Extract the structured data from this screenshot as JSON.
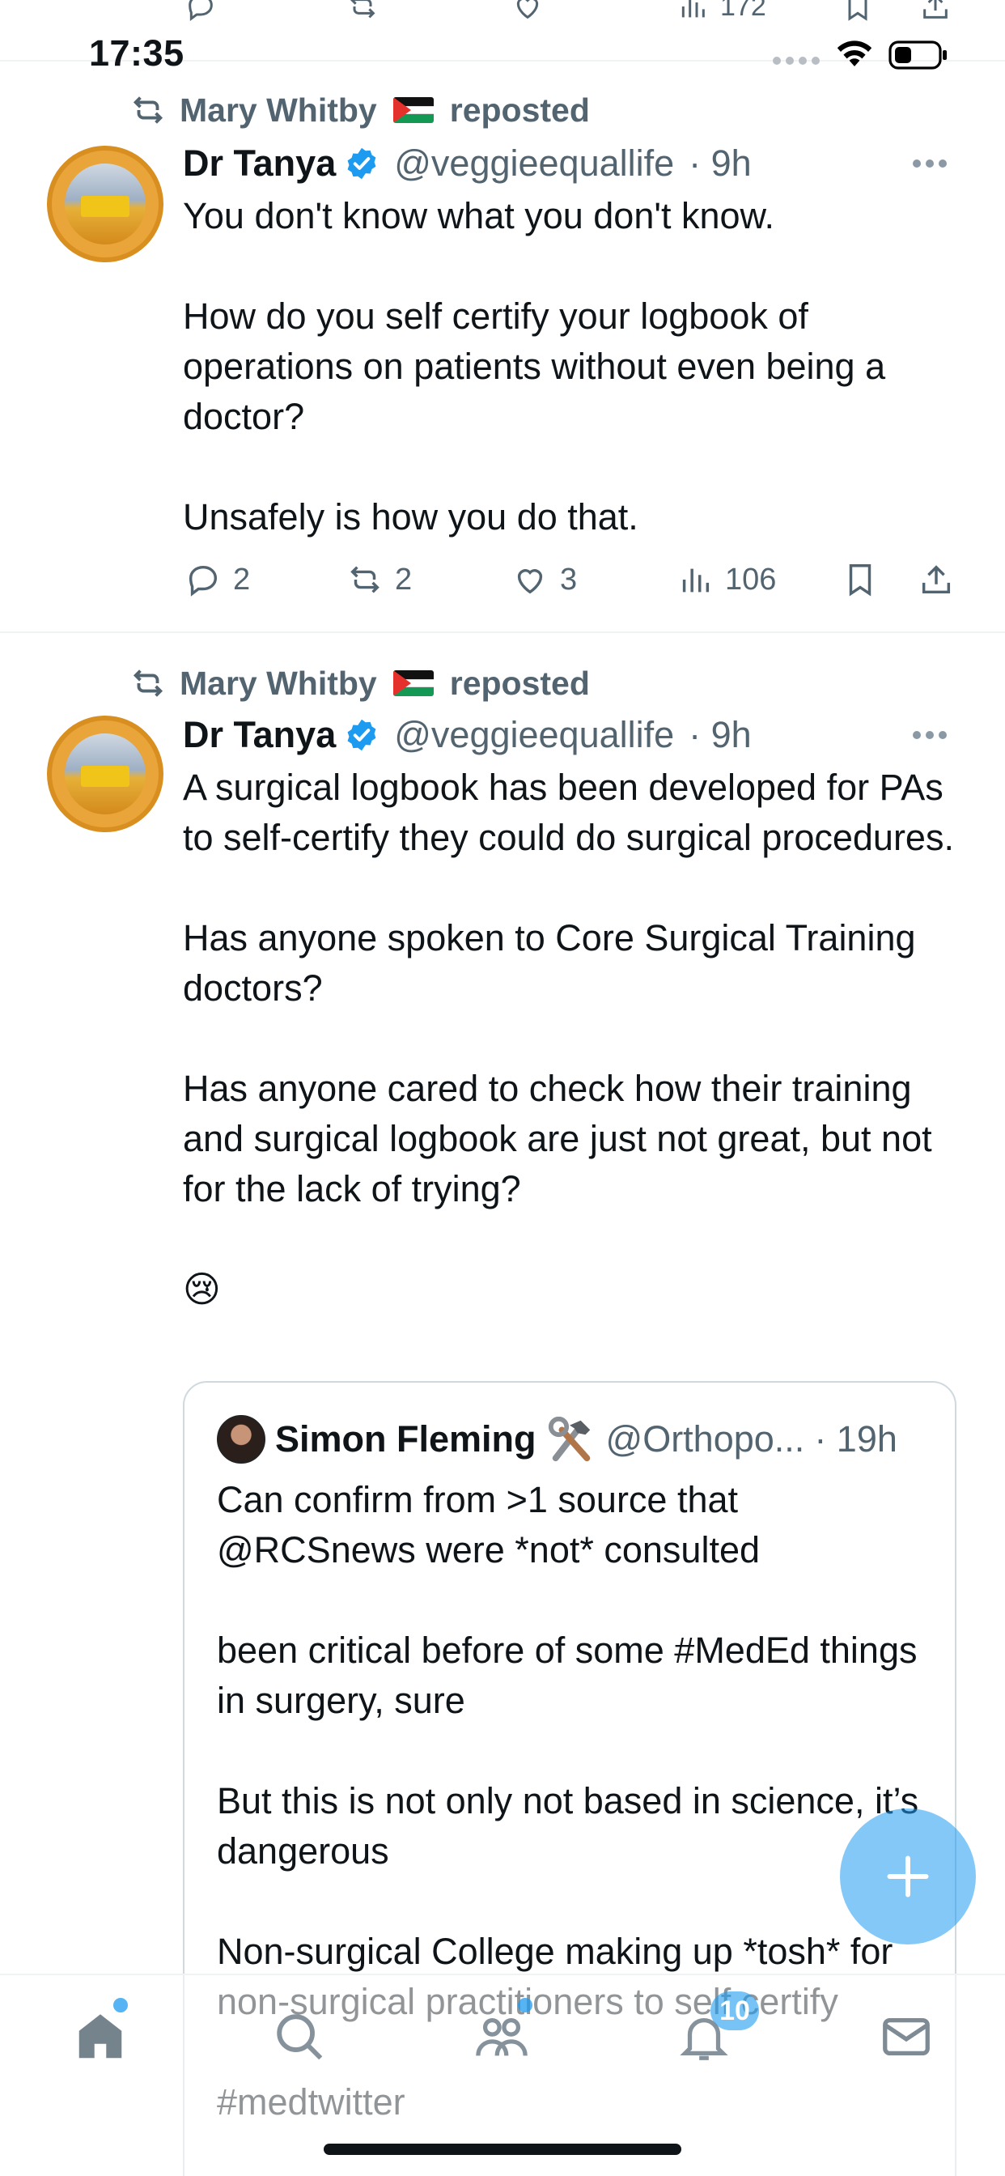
{
  "status_bar": {
    "time": "17:35"
  },
  "previous_tweet": {
    "views_partial": "172"
  },
  "tweets": [
    {
      "reposted_by": "Mary Whitby",
      "reposted_label": "reposted",
      "author_name": "Dr Tanya",
      "handle": "@veggieequallife",
      "time": "· 9h",
      "text": "You don't know what you don't know.\n\nHow do you self certify your logbook of operations on patients without even being a doctor?\n\nUnsafely is how you do that.",
      "replies": "2",
      "reposts": "2",
      "likes": "3",
      "views": "106"
    },
    {
      "reposted_by": "Mary Whitby",
      "reposted_label": "reposted",
      "author_name": "Dr Tanya",
      "handle": "@veggieequallife",
      "time": "· 9h",
      "text": "A surgical logbook has been developed for PAs to self-certify they could do surgical procedures.\n\nHas anyone spoken to Core Surgical Training doctors?\n\nHas anyone cared to check how their training and surgical logbook are just not great, but not for the lack of trying?\n\n😢",
      "quote": {
        "author_name": "Simon Fleming",
        "handle": "@Orthopo...",
        "time": "· 19h",
        "text": "Can confirm from >1 source that @RCSnews were *not* consulted\n\nbeen critical before of some #MedEd things in surgery, sure\n\nBut this is not only not based in science, it’s dangerous\n\nNon-surgical College making up *tosh* for non-surgical practitioners to self certify\n\n#medtwitter"
      }
    }
  ],
  "tab_bar": {
    "notifications_badge": "10"
  },
  "icons": {
    "reply": "reply-icon",
    "repost": "repost-icon",
    "like": "like-icon",
    "views": "views-icon",
    "bookmark": "bookmark-icon",
    "share": "share-icon",
    "verified": "verified-badge-icon",
    "compose": "compose-plus-icon",
    "home": "home-icon",
    "search": "search-icon",
    "communities": "communities-icon",
    "notifications": "bell-icon",
    "messages": "mail-icon"
  },
  "colors": {
    "accent": "#1d9bf0",
    "muted": "#536471",
    "text": "#0f1419",
    "divider": "#eff3f4"
  }
}
